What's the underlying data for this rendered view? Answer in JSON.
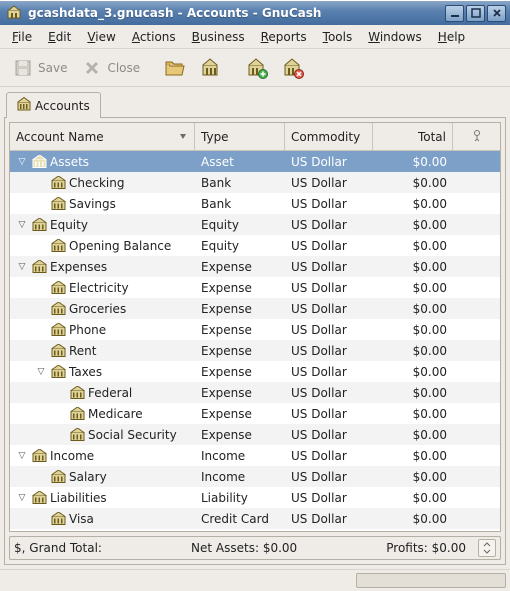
{
  "window": {
    "title": "gcashdata_3.gnucash - Accounts - GnuCash"
  },
  "menus": [
    "File",
    "Edit",
    "View",
    "Actions",
    "Business",
    "Reports",
    "Tools",
    "Windows",
    "Help"
  ],
  "toolbar": {
    "save_label": "Save",
    "close_label": "Close"
  },
  "tab": {
    "label": "Accounts"
  },
  "columns": {
    "name": "Account Name",
    "type": "Type",
    "commodity": "Commodity",
    "total": "Total"
  },
  "rows": [
    {
      "depth": 0,
      "exp": "down",
      "name": "Assets",
      "type": "Asset",
      "comm": "US Dollar",
      "total": "$0.00",
      "sel": true
    },
    {
      "depth": 1,
      "exp": "",
      "name": "Checking",
      "type": "Bank",
      "comm": "US Dollar",
      "total": "$0.00"
    },
    {
      "depth": 1,
      "exp": "",
      "name": "Savings",
      "type": "Bank",
      "comm": "US Dollar",
      "total": "$0.00"
    },
    {
      "depth": 0,
      "exp": "down",
      "name": "Equity",
      "type": "Equity",
      "comm": "US Dollar",
      "total": "$0.00"
    },
    {
      "depth": 1,
      "exp": "",
      "name": "Opening Balance",
      "type": "Equity",
      "comm": "US Dollar",
      "total": "$0.00"
    },
    {
      "depth": 0,
      "exp": "down",
      "name": "Expenses",
      "type": "Expense",
      "comm": "US Dollar",
      "total": "$0.00"
    },
    {
      "depth": 1,
      "exp": "",
      "name": "Electricity",
      "type": "Expense",
      "comm": "US Dollar",
      "total": "$0.00"
    },
    {
      "depth": 1,
      "exp": "",
      "name": "Groceries",
      "type": "Expense",
      "comm": "US Dollar",
      "total": "$0.00"
    },
    {
      "depth": 1,
      "exp": "",
      "name": "Phone",
      "type": "Expense",
      "comm": "US Dollar",
      "total": "$0.00"
    },
    {
      "depth": 1,
      "exp": "",
      "name": "Rent",
      "type": "Expense",
      "comm": "US Dollar",
      "total": "$0.00"
    },
    {
      "depth": 1,
      "exp": "down",
      "name": "Taxes",
      "type": "Expense",
      "comm": "US Dollar",
      "total": "$0.00"
    },
    {
      "depth": 2,
      "exp": "",
      "name": "Federal",
      "type": "Expense",
      "comm": "US Dollar",
      "total": "$0.00"
    },
    {
      "depth": 2,
      "exp": "",
      "name": "Medicare",
      "type": "Expense",
      "comm": "US Dollar",
      "total": "$0.00"
    },
    {
      "depth": 2,
      "exp": "",
      "name": "Social Security",
      "type": "Expense",
      "comm": "US Dollar",
      "total": "$0.00"
    },
    {
      "depth": 0,
      "exp": "down",
      "name": "Income",
      "type": "Income",
      "comm": "US Dollar",
      "total": "$0.00"
    },
    {
      "depth": 1,
      "exp": "",
      "name": "Salary",
      "type": "Income",
      "comm": "US Dollar",
      "total": "$0.00"
    },
    {
      "depth": 0,
      "exp": "down",
      "name": "Liabilities",
      "type": "Liability",
      "comm": "US Dollar",
      "total": "$0.00"
    },
    {
      "depth": 1,
      "exp": "",
      "name": "Visa",
      "type": "Credit Card",
      "comm": "US Dollar",
      "total": "$0.00"
    }
  ],
  "summary": {
    "currency_label": "$, Grand Total:",
    "net_assets": "Net Assets: $0.00",
    "profits": "Profits: $0.00"
  }
}
